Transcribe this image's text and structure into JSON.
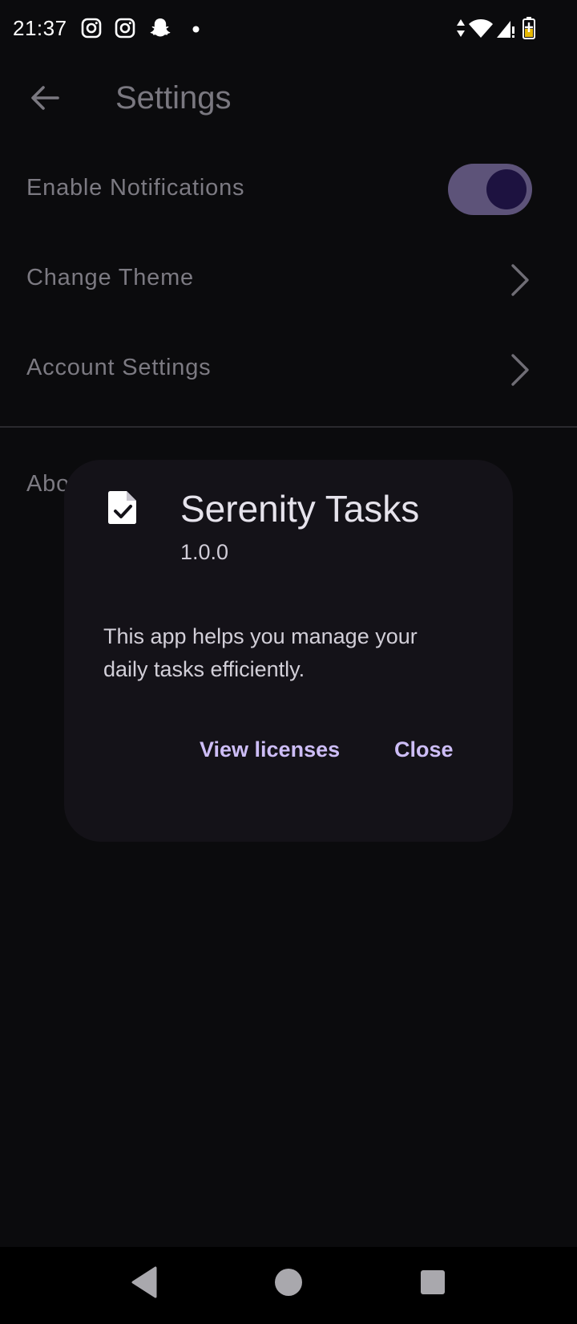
{
  "status_bar": {
    "time": "21:37",
    "notification_icons": [
      "instagram-icon",
      "instagram-icon",
      "snapchat-icon",
      "dot-icon"
    ],
    "system_icons": [
      "data-arrows-icon",
      "wifi-icon",
      "signal-icon",
      "battery-charging-icon"
    ]
  },
  "app_bar": {
    "back_icon": "arrow-left-icon",
    "title": "Settings"
  },
  "settings": {
    "items": [
      {
        "label": "Enable Notifications",
        "control": "switch",
        "on": true
      },
      {
        "label": "Change Theme",
        "control": "chevron-right-icon"
      },
      {
        "label": "Account Settings",
        "control": "chevron-right-icon"
      }
    ],
    "about_label": "About"
  },
  "dialog": {
    "icon": "task-file-check-icon",
    "title": "Serenity Tasks",
    "version": "1.0.0",
    "body": "This app helps you manage your daily tasks efficiently.",
    "buttons": {
      "licenses": "View licenses",
      "close": "Close"
    }
  },
  "nav_bar": {
    "buttons": [
      "back-triangle-icon",
      "home-circle-icon",
      "recents-square-icon"
    ]
  },
  "colors": {
    "background": "#0b0b0d",
    "dialog": "#141218",
    "accent_text": "#cdbdf6",
    "switch_track": "#5d5379",
    "switch_knob": "#1d1240"
  }
}
